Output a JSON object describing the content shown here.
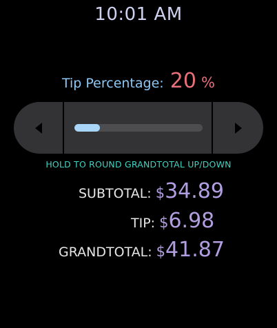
{
  "status_bar": {
    "time": "10:01 AM"
  },
  "tip": {
    "label": "Tip Percentage:",
    "value": "20",
    "unit": "%",
    "slider_fraction": 0.2
  },
  "stepper": {
    "decrease_icon": "triangle-left-icon",
    "increase_icon": "triangle-right-icon"
  },
  "hint": "HOLD TO ROUND GRANDTOTAL UP/DOWN",
  "totals": {
    "subtotal": {
      "label": "SUBTOTAL:",
      "currency": "$",
      "amount": "34.89"
    },
    "tip": {
      "label": "TIP:",
      "currency": "$",
      "amount": "6.98"
    },
    "grandtotal": {
      "label": "GRANDTOTAL:",
      "currency": "$",
      "amount": "41.87"
    }
  },
  "colors": {
    "clock": "#cfd2ee",
    "tip_label": "#8ec8f5",
    "tip_value": "#e8707a",
    "hint": "#40d3c2",
    "amounts": "#b19ee0",
    "slider_fill": "#a9d5f9"
  }
}
